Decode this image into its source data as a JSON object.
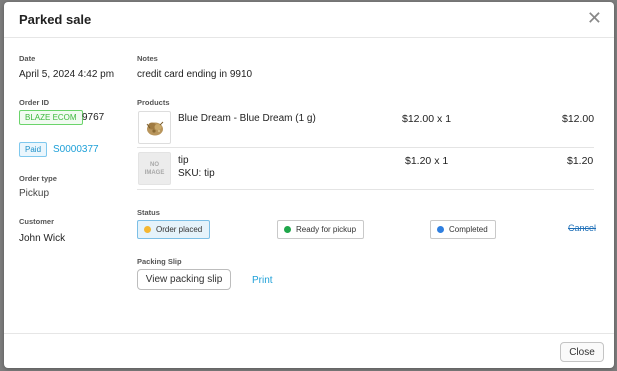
{
  "modal": {
    "title": "Parked sale",
    "close_icon": "close-icon"
  },
  "left": {
    "date_label": "Date",
    "date_value": "April 5, 2024 4:42 pm",
    "order_id_label": "Order ID",
    "order_source_badge": "BLAZE ECOM",
    "order_id": "9767",
    "payment_badge": "Paid",
    "order_number": "S0000377",
    "order_type_label": "Order type",
    "order_type_value": "Pickup",
    "customer_label": "Customer",
    "customer_value": "John Wick"
  },
  "notes": {
    "label": "Notes",
    "value": "credit card ending in 9910"
  },
  "products": {
    "label": "Products",
    "items": [
      {
        "name": "Blue Dream - Blue Dream (1 g)",
        "sku": "",
        "unit_price": "$12.00 x 1",
        "total": "$12.00",
        "image": "product-thumbnail"
      },
      {
        "name": "tip",
        "sku": "SKU: tip",
        "unit_price": "$1.20 x 1",
        "total": "$1.20",
        "image": "no-image",
        "no_image_line1": "NO",
        "no_image_line2": "IMAGE"
      }
    ]
  },
  "status": {
    "label": "Status",
    "options": [
      {
        "label": "Order placed",
        "color": "#f5b731",
        "active": true
      },
      {
        "label": "Ready for pickup",
        "color": "#1fa64a",
        "active": false
      },
      {
        "label": "Completed",
        "color": "#2f7fe0",
        "active": false
      }
    ],
    "cancel_label": "Cancel"
  },
  "packing_slip": {
    "label": "Packing Slip",
    "view_button": "View packing slip",
    "print_link": "Print"
  },
  "footer": {
    "close_button": "Close"
  }
}
